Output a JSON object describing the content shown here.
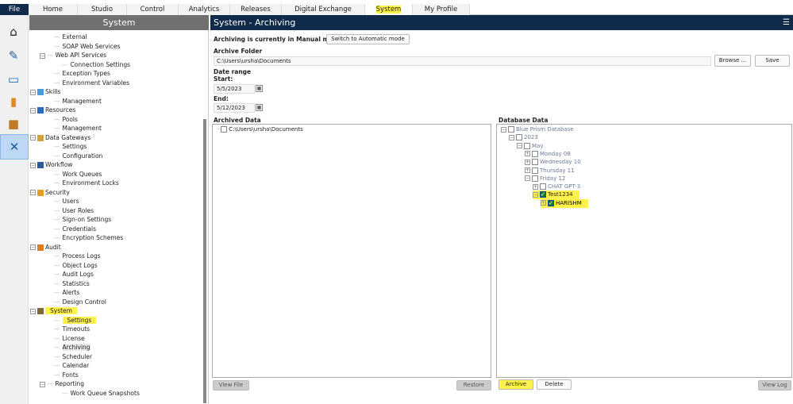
{
  "menu": {
    "file": "File",
    "tabs": [
      "Home",
      "Studio",
      "Control",
      "Analytics",
      "Releases",
      "Digital Exchange",
      "System",
      "My Profile"
    ],
    "active": "System"
  },
  "iconbar": [
    "home-icon",
    "design-icon",
    "control-icon",
    "analytics-icon",
    "package-icon",
    "system-tools-icon"
  ],
  "tree": {
    "title": "System",
    "items": [
      {
        "label": "External",
        "level": 1
      },
      {
        "label": "SOAP Web Services",
        "level": 1
      },
      {
        "label": "Web API Services",
        "level": 1,
        "expander": true
      },
      {
        "label": "Connection Settings",
        "level": 2
      },
      {
        "label": "Exception Types",
        "level": 1
      },
      {
        "label": "Environment Variables",
        "level": 1
      },
      {
        "label": "Skills",
        "level": 0,
        "icon": "skills-icon"
      },
      {
        "label": "Management",
        "level": 1
      },
      {
        "label": "Resources",
        "level": 0,
        "icon": "resources-icon"
      },
      {
        "label": "Pools",
        "level": 1
      },
      {
        "label": "Management",
        "level": 1
      },
      {
        "label": "Data Gateways",
        "level": 0,
        "icon": "data-gateways-icon"
      },
      {
        "label": "Settings",
        "level": 1
      },
      {
        "label": "Configuration",
        "level": 1
      },
      {
        "label": "Workflow",
        "level": 0,
        "icon": "workflow-icon"
      },
      {
        "label": "Work Queues",
        "level": 1
      },
      {
        "label": "Environment Locks",
        "level": 1
      },
      {
        "label": "Security",
        "level": 0,
        "icon": "security-key-icon"
      },
      {
        "label": "Users",
        "level": 1
      },
      {
        "label": "User Roles",
        "level": 1
      },
      {
        "label": "Sign-on Settings",
        "level": 1
      },
      {
        "label": "Credentials",
        "level": 1
      },
      {
        "label": "Encryption Schemes",
        "level": 1
      },
      {
        "label": "Audit",
        "level": 0,
        "icon": "audit-icon"
      },
      {
        "label": "Process Logs",
        "level": 1
      },
      {
        "label": "Object Logs",
        "level": 1
      },
      {
        "label": "Audit Logs",
        "level": 1
      },
      {
        "label": "Statistics",
        "level": 1
      },
      {
        "label": "Alerts",
        "level": 1
      },
      {
        "label": "Design Control",
        "level": 1
      },
      {
        "label": "System",
        "level": 0,
        "icon": "system-icon",
        "highlight": true
      },
      {
        "label": "Settings",
        "level": 1,
        "highlight": true
      },
      {
        "label": "Timeouts",
        "level": 1
      },
      {
        "label": "License",
        "level": 1
      },
      {
        "label": "Archiving",
        "level": 1,
        "selected": true
      },
      {
        "label": "Scheduler",
        "level": 1
      },
      {
        "label": "Calendar",
        "level": 1
      },
      {
        "label": "Fonts",
        "level": 1
      },
      {
        "label": "Reporting",
        "level": 1,
        "expander": true
      },
      {
        "label": "Work Queue Snapshots",
        "level": 2
      }
    ]
  },
  "main": {
    "title": "System - Archiving",
    "mode_text": "Archiving is currently in Manual mode",
    "switch_button": "Switch to Automatic mode",
    "archive_folder_label": "Archive Folder",
    "archive_folder": "C:\\Users\\ursha\\Documents",
    "browse": "Browse ...",
    "save": "Save",
    "date_range": "Date range",
    "start_label": "Start:",
    "start": "5/5/2023",
    "end_label": "End:",
    "end": "5/12/2023",
    "archived_label": "Archived Data",
    "archived_root": "C:\\Users\\ursha\\Documents",
    "database_label": "Database Data",
    "db_tree": [
      {
        "label": "Blue Prism Database",
        "level": 0,
        "exp": "-"
      },
      {
        "label": "2023",
        "level": 1,
        "exp": "-"
      },
      {
        "label": "May",
        "level": 2,
        "exp": "-"
      },
      {
        "label": "Monday 08",
        "level": 3,
        "exp": "+"
      },
      {
        "label": "Wednesday 10",
        "level": 3,
        "exp": "+"
      },
      {
        "label": "Thursday 11",
        "level": 3,
        "exp": "+"
      },
      {
        "label": "Friday 12",
        "level": 3,
        "exp": "-"
      },
      {
        "label": "CHAT GPT-3",
        "level": 4,
        "exp": "+"
      },
      {
        "label": "Test1234",
        "level": 4,
        "exp": "-",
        "checked": true,
        "highlight": true
      },
      {
        "label": "HARISHM",
        "level": 5,
        "exp": "+",
        "checked": true,
        "highlight": true
      }
    ],
    "view_file": "View File",
    "restore": "Restore",
    "archive": "Archive",
    "delete": "Delete",
    "view_log": "View Log"
  }
}
